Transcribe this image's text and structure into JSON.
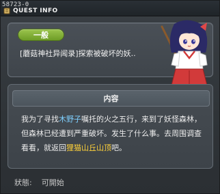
{
  "window": {
    "quest_id": "58723-0",
    "title": "QUEST INFO"
  },
  "summary": {
    "type_badge": "一般",
    "quest_title": "[蘑菇神社异闻录]探索被破坏的妖.."
  },
  "detail": {
    "header": "内容",
    "body_segments": [
      {
        "text": "我为了寻找",
        "style": "normal"
      },
      {
        "text": "木野子",
        "style": "blue"
      },
      {
        "text": "嘱托的火之五行，来到了妖怪森林，但森林已经遭到严重破坏。发生了什么事。去周围调查看看，就返回",
        "style": "normal"
      },
      {
        "text": "狸猫山丘山顶",
        "style": "yellow"
      },
      {
        "text": "吧。",
        "style": "normal"
      }
    ]
  },
  "status": {
    "label": "狀態:",
    "value": "可開始"
  },
  "icons": {
    "title_icon": "scroll-icon",
    "npc": "shrine-maiden-npc-portrait"
  },
  "colors": {
    "badge_green": "#7fae35",
    "npc_name_highlight": "#7fd0ff",
    "location_highlight": "#ffd23a"
  }
}
